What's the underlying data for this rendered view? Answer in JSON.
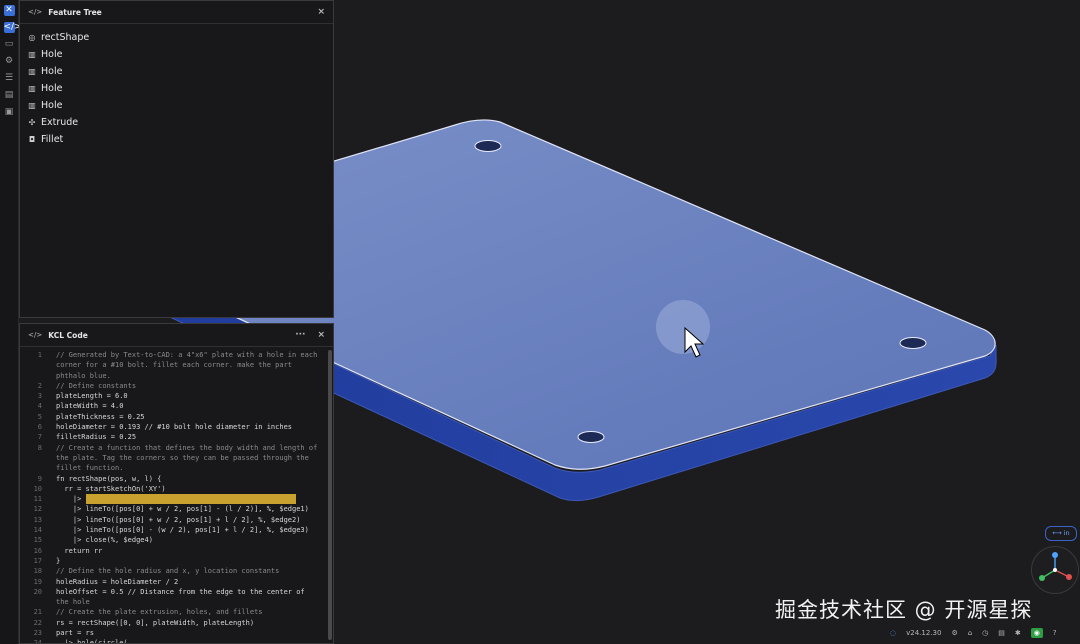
{
  "tree": {
    "title": "Feature Tree",
    "items": [
      {
        "label": "rectShape",
        "icon": "sketch-icon"
      },
      {
        "label": "Hole",
        "icon": "hole-icon"
      },
      {
        "label": "Hole",
        "icon": "hole-icon"
      },
      {
        "label": "Hole",
        "icon": "hole-icon"
      },
      {
        "label": "Hole",
        "icon": "hole-icon"
      },
      {
        "label": "Extrude",
        "icon": "extrude-icon"
      },
      {
        "label": "Fillet",
        "icon": "fillet-icon"
      }
    ]
  },
  "code": {
    "title": "KCL Code",
    "lines": [
      {
        "n": "1",
        "t": "// Generated by Text-to-CAD: a 4\"x6\" plate with a hole in each"
      },
      {
        "n": "",
        "t": "corner for a #10 bolt. fillet each corner. make the part"
      },
      {
        "n": "",
        "t": "phthalo blue."
      },
      {
        "n": "2",
        "t": "// Define constants"
      },
      {
        "n": "3",
        "t": "plateLength = 6.0"
      },
      {
        "n": "4",
        "t": "plateWidth = 4.0"
      },
      {
        "n": "5",
        "t": "plateThickness = 0.25"
      },
      {
        "n": "6",
        "t": "holeDiameter = 0.193 // #10 bolt hole diameter in inches"
      },
      {
        "n": "7",
        "t": "filletRadius = 0.25"
      },
      {
        "n": "8",
        "t": "// Create a function that defines the body width and length of"
      },
      {
        "n": "",
        "t": "the plate. Tag the corners so they can be passed through the"
      },
      {
        "n": "",
        "t": "fillet function."
      },
      {
        "n": "9",
        "t": "fn rectShape(pos, w, l) {"
      },
      {
        "n": "10",
        "t": "  rr = startSketchOn('XY')"
      },
      {
        "n": "11",
        "t": "    |> "
      },
      {
        "n": "12",
        "t": "    |> lineTo([pos[0] + w / 2, pos[1] - (l / 2)], %, $edge1)"
      },
      {
        "n": "13",
        "t": "    |> lineTo([pos[0] + w / 2, pos[1] + l / 2], %, $edge2)"
      },
      {
        "n": "14",
        "t": "    |> lineTo([pos[0] - (w / 2), pos[1] + l / 2], %, $edge3)"
      },
      {
        "n": "15",
        "t": "    |> close(%, $edge4)"
      },
      {
        "n": "16",
        "t": "  return rr"
      },
      {
        "n": "17",
        "t": "}"
      },
      {
        "n": "18",
        "t": "// Define the hole radius and x, y location constants"
      },
      {
        "n": "19",
        "t": "holeRadius = holeDiameter / 2"
      },
      {
        "n": "20",
        "t": "holeOffset = 0.5 // Distance from the edge to the center of"
      },
      {
        "n": "",
        "t": "the hole"
      },
      {
        "n": "21",
        "t": "// Create the plate extrusion, holes, and fillets"
      },
      {
        "n": "22",
        "t": "rs = rectShape([0, 0], plateWidth, plateLength)"
      },
      {
        "n": "23",
        "t": "part = rs"
      },
      {
        "n": "24",
        "t": "  |> hole(circle("
      }
    ]
  },
  "status": {
    "version": "v24.12.30",
    "unit": "in",
    "network": "ok"
  },
  "watermark": "掘金技术社区 @ 开源星探",
  "colors": {
    "plate_top": "#6f86c4",
    "plate_side": "#2a46a8",
    "accent": "#3b6fd8"
  }
}
